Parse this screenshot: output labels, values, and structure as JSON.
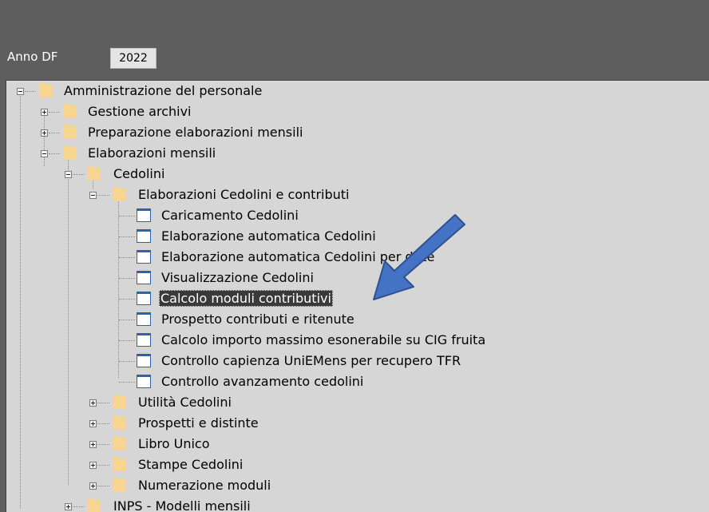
{
  "header": {
    "year_label": "Anno DF",
    "year_value": "2022"
  },
  "tree": {
    "root": "Amministrazione del personale",
    "gestione_archivi": "Gestione archivi",
    "preparazione": "Preparazione elaborazioni mensili",
    "elaborazioni_mensili": "Elaborazioni mensili",
    "cedolini": "Cedolini",
    "elab_cedolini_contributi": "Elaborazioni Cedolini e contributi",
    "items": [
      "Caricamento Cedolini",
      "Elaborazione automatica Cedolini",
      "Elaborazione automatica Cedolini per ditte",
      "Visualizzazione Cedolini",
      "Calcolo moduli contributivi",
      "Prospetto contributi e ritenute",
      "Calcolo importo massimo esonerabile su CIG fruita",
      "Controllo capienza UniEMens per recupero TFR",
      "Controllo avanzamento cedolini"
    ],
    "utilita": "Utilità Cedolini",
    "prospetti": "Prospetti e distinte",
    "libro_unico": "Libro Unico",
    "stampe": "Stampe Cedolini",
    "numerazione": "Numerazione moduli",
    "inps": "INPS - Modelli mensili"
  },
  "colors": {
    "selected_bg": "#3a3a3a",
    "arrow": "#4472c4",
    "panel_bg": "#d6d6d6",
    "folder": "#f6d58f"
  },
  "icons": {
    "folder": "folder-icon",
    "document": "document-icon",
    "expand": "plus-icon",
    "collapse": "minus-icon",
    "pointer": "arrow-icon"
  }
}
